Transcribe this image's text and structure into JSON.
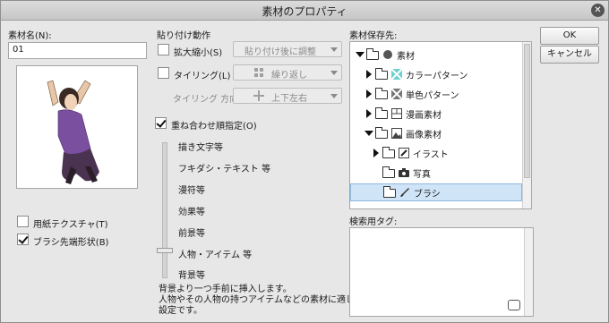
{
  "window": {
    "title": "素材のプロパティ",
    "close_glyph": "✕"
  },
  "material_name": {
    "label": "素材名(N):",
    "value": "01"
  },
  "preview": {
    "description_icon": "person-figure-icon"
  },
  "left_checks": [
    {
      "label": "用紙テクスチャ(T)",
      "checked": false
    },
    {
      "label": "ブラシ先端形状(B)",
      "checked": true
    }
  ],
  "paste": {
    "header": "貼り付け動作",
    "scale": {
      "label": "拡大縮小(S)",
      "checked": false,
      "dropdown": "貼り付け後に調整"
    },
    "tiling": {
      "label": "タイリング(L)",
      "checked": false,
      "dropdown": "繰り返し"
    },
    "tiling_dir": {
      "label": "タイリング 方向:",
      "dropdown": "上下左右"
    }
  },
  "order": {
    "label": "重ね合わせ順指定(O)",
    "checked": true,
    "items": [
      "描き文字等",
      "フキダシ・テキスト 等",
      "漫符等",
      "効果等",
      "前景等",
      "人物・アイテム 等",
      "背景等"
    ],
    "selected_index": 5
  },
  "description": {
    "line1": "背景より一つ手前に挿入します。",
    "line2": "人物やその人物の持つアイテムなどの素材に適した",
    "line3": "設定です。"
  },
  "save_location": {
    "label": "素材保存先:",
    "tree": [
      {
        "label": "素材",
        "icon": "material-root-icon",
        "expanded": true
      },
      {
        "label": "カラーパターン",
        "icon": "color-pattern-icon",
        "expanded": false
      },
      {
        "label": "単色パターン",
        "icon": "mono-pattern-icon",
        "expanded": false
      },
      {
        "label": "漫画素材",
        "icon": "manga-material-icon",
        "expanded": false
      },
      {
        "label": "画像素材",
        "icon": "image-material-icon",
        "expanded": true
      },
      {
        "label": "イラスト",
        "icon": "illustration-icon",
        "expanded": false
      },
      {
        "label": "写真",
        "icon": "camera-icon",
        "expanded": false
      },
      {
        "label": "ブラシ",
        "icon": "brush-icon",
        "selected": true
      }
    ]
  },
  "search_tag": {
    "label": "検索用タグ:"
  },
  "buttons": {
    "ok": "OK",
    "cancel": "キャンセル"
  },
  "colors": {
    "selection": "#cfe4f7",
    "accent_purple": "#7a4fa0"
  }
}
